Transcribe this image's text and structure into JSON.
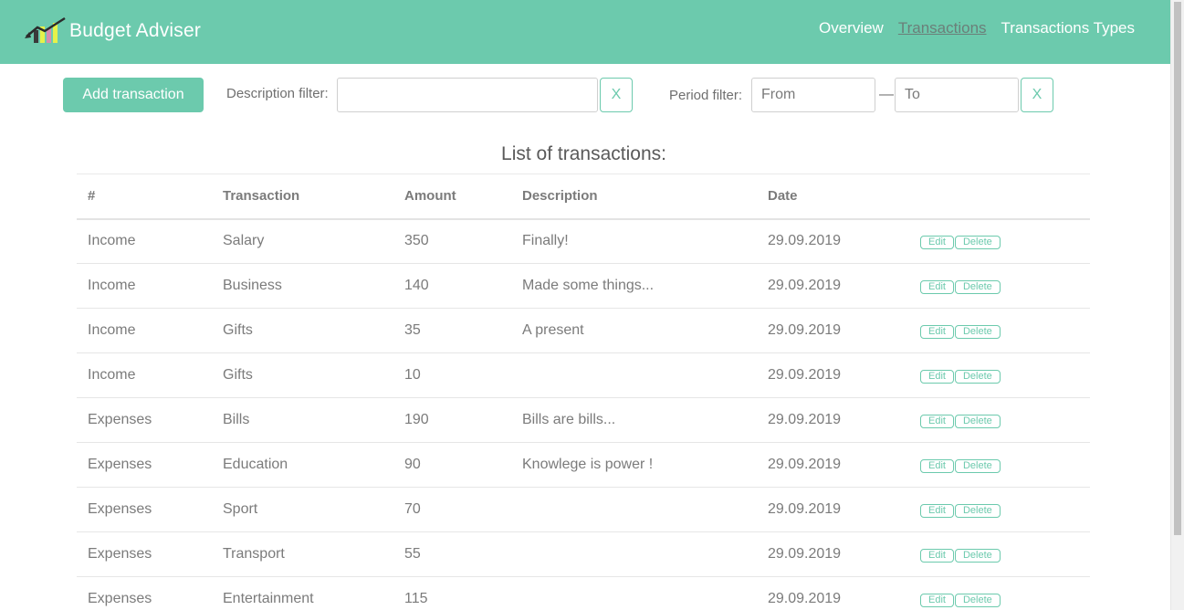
{
  "header": {
    "brand": "Budget Adviser",
    "nav": [
      "Overview",
      "Transactions",
      "Transactions Types"
    ],
    "active": "Transactions"
  },
  "toolbar": {
    "add_label": "Add transaction",
    "description_filter_label": "Description filter:",
    "description_filter_value": "",
    "clear_label": "X",
    "period_filter_label": "Period filter:",
    "from_placeholder": "From",
    "period_separator": "—",
    "to_placeholder": "To"
  },
  "table": {
    "title": "List of transactions:",
    "headers": [
      "#",
      "Transaction",
      "Amount",
      "Description",
      "Date",
      ""
    ],
    "edit_label": "Edit",
    "delete_label": "Delete",
    "rows": [
      {
        "type": "Income",
        "transaction": "Salary",
        "amount": "350",
        "description": "Finally!",
        "date": "29.09.2019"
      },
      {
        "type": "Income",
        "transaction": "Business",
        "amount": "140",
        "description": "Made some things...",
        "date": "29.09.2019"
      },
      {
        "type": "Income",
        "transaction": "Gifts",
        "amount": "35",
        "description": "A present",
        "date": "29.09.2019"
      },
      {
        "type": "Income",
        "transaction": "Gifts",
        "amount": "10",
        "description": "",
        "date": "29.09.2019"
      },
      {
        "type": "Expenses",
        "transaction": "Bills",
        "amount": "190",
        "description": "Bills are bills...",
        "date": "29.09.2019"
      },
      {
        "type": "Expenses",
        "transaction": "Education",
        "amount": "90",
        "description": "Knowlege is power !",
        "date": "29.09.2019"
      },
      {
        "type": "Expenses",
        "transaction": "Sport",
        "amount": "70",
        "description": "",
        "date": "29.09.2019"
      },
      {
        "type": "Expenses",
        "transaction": "Transport",
        "amount": "55",
        "description": "",
        "date": "29.09.2019"
      },
      {
        "type": "Expenses",
        "transaction": "Entertainment",
        "amount": "115",
        "description": "",
        "date": "29.09.2019"
      }
    ]
  },
  "colors": {
    "accent": "#6ccaad",
    "active_nav": "#6b7f79",
    "text": "#7b7b7b"
  }
}
